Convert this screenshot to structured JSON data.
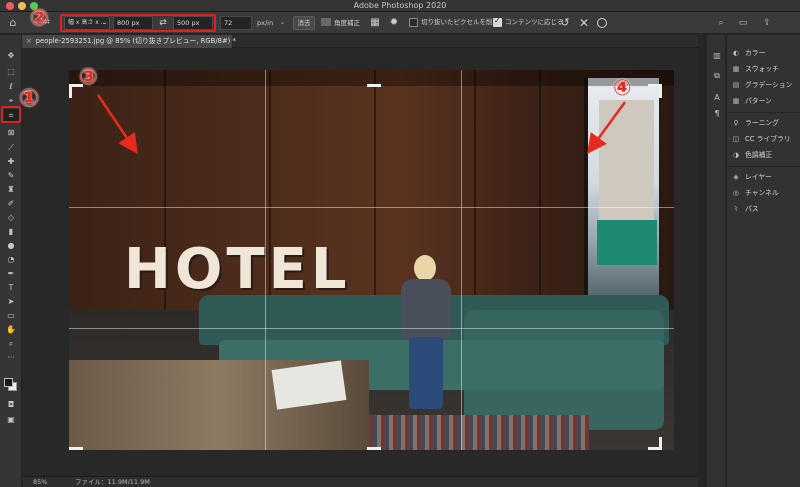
{
  "window": {
    "title": "Adobe Photoshop 2020"
  },
  "options_bar": {
    "home_icon": "home-icon",
    "tool_icon": "crop-icon",
    "ratio_preset": "幅 x 高さ x ...",
    "width": "800 px",
    "height": "500 px",
    "resolution": "72",
    "resolution_unit": "px/in",
    "clear_label": "消去",
    "straighten_label": "角度補正",
    "delete_pixels_label": "切り抜いたピクセルを削除",
    "delete_pixels_checked": false,
    "content_aware_label": "コンテンツに応じる",
    "content_aware_checked": true
  },
  "document_tab": {
    "close": "×",
    "label": "people-2593251.jpg @ 85% (切り抜きプレビュー, RGB/8#) *"
  },
  "photo": {
    "sign_text": "HOTEL"
  },
  "annotations": {
    "n1": "①",
    "n2": "②",
    "n3": "③",
    "n4": "④",
    "color": "#e82a1e"
  },
  "panels": {
    "items": [
      {
        "icon": "color-palette-icon",
        "glyph": "◐",
        "label": "カラー"
      },
      {
        "icon": "swatches-icon",
        "glyph": "▦",
        "label": "スウォッチ"
      },
      {
        "icon": "gradient-icon",
        "glyph": "▤",
        "label": "グラデーション"
      },
      {
        "icon": "pattern-icon",
        "glyph": "▦",
        "label": "パターン"
      },
      {
        "icon": "lightbulb-icon",
        "glyph": "♀",
        "label": "ラーニング"
      },
      {
        "icon": "cc-libraries-icon",
        "glyph": "◫",
        "label": "CC ライブラリ"
      },
      {
        "icon": "adjustments-icon",
        "glyph": "◑",
        "label": "色調補正"
      },
      {
        "icon": "layers-icon",
        "glyph": "◈",
        "label": "レイヤー"
      },
      {
        "icon": "channels-icon",
        "glyph": "◎",
        "label": "チャンネル"
      },
      {
        "icon": "paths-icon",
        "glyph": "⌇",
        "label": "パス"
      }
    ]
  },
  "status_bar": {
    "zoom": "85%",
    "file_info": "ファイル：11.9M/11.9M"
  }
}
